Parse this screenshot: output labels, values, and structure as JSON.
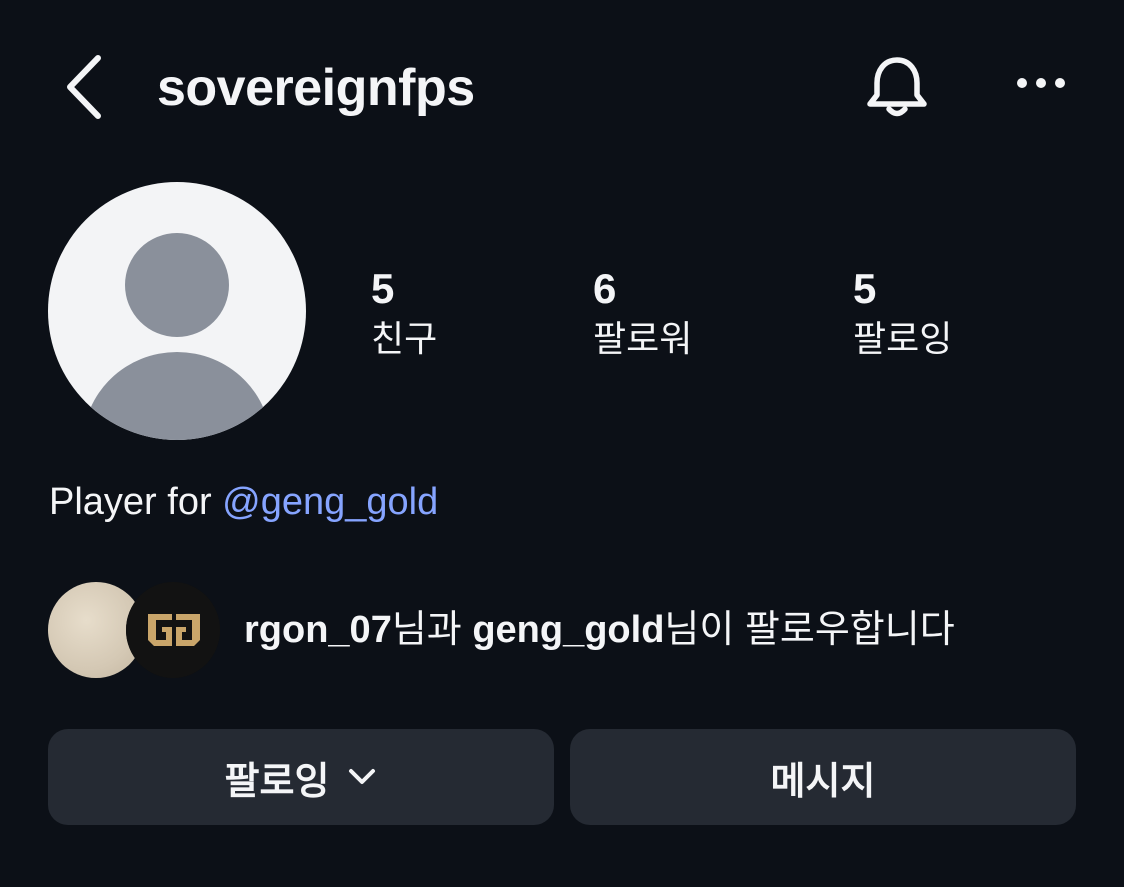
{
  "header": {
    "username": "sovereignfps",
    "back_icon": "chevron-left-icon",
    "bell_icon": "bell-icon",
    "more_icon": "more-horizontal-icon"
  },
  "profile": {
    "avatar_icon": "default-avatar-icon",
    "stats": [
      {
        "value": "5",
        "label": "친구"
      },
      {
        "value": "6",
        "label": "팔로워"
      },
      {
        "value": "5",
        "label": "팔로잉"
      }
    ],
    "bio_prefix": "Player for ",
    "bio_link": "@geng_gold"
  },
  "mutual": {
    "user1": "rgon_07",
    "connector": "님과 ",
    "user2": "geng_gold",
    "suffix": "님이 팔로우합니다",
    "logo_text": "GG"
  },
  "actions": {
    "follow_label": "팔로잉",
    "message_label": "메시지"
  },
  "colors": {
    "background": "#0c1017",
    "link": "#86a4ff",
    "button": "#252a33"
  }
}
